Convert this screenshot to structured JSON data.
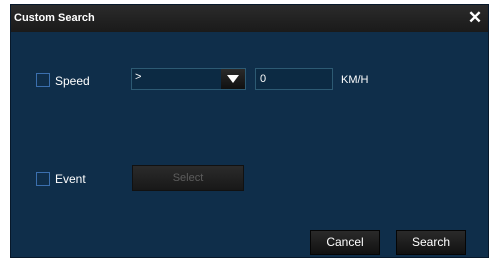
{
  "dialog": {
    "title": "Custom Search",
    "close_glyph": "✕"
  },
  "speed": {
    "label": "Speed",
    "checked": false,
    "operator": ">",
    "value": "0",
    "unit": "KM/H"
  },
  "event": {
    "label": "Event",
    "checked": false,
    "select_label": "Select"
  },
  "footer": {
    "cancel_label": "Cancel",
    "search_label": "Search"
  },
  "colors": {
    "dialog_bg": "#0f2e4a",
    "titlebar_bg": "#1f1f1f",
    "field_border": "#2d5a73",
    "checkbox_border": "#3b6fae"
  }
}
